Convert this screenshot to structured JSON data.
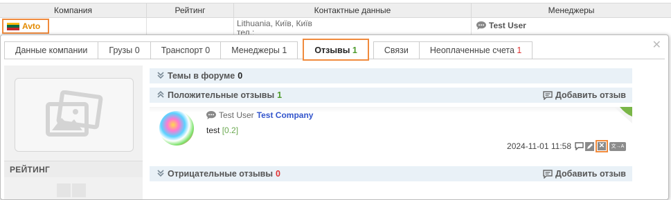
{
  "table": {
    "headers": [
      "Компания",
      "Рейтинг",
      "Контактные данные",
      "Менеджеры"
    ],
    "row": {
      "company": "Avto",
      "contact_line1": "Lithuania, Київ, Київ",
      "contact_line2": "тел.:",
      "manager": "Test User"
    }
  },
  "modal": {
    "tabs": [
      {
        "label": "Данные компании",
        "count": ""
      },
      {
        "label": "Грузы",
        "count": "0"
      },
      {
        "label": "Транспорт",
        "count": "0"
      },
      {
        "label": "Менеджеры",
        "count": "1"
      },
      {
        "label": "Отзывы",
        "count": "1"
      },
      {
        "label": "Связи",
        "count": ""
      },
      {
        "label": "Неоплаченные счета",
        "count": "1"
      }
    ],
    "active_tab": "Отзывы",
    "sidebar": {
      "rating_label": "РЕЙТИНГ"
    },
    "sections": {
      "forum": {
        "label": "Темы в форуме",
        "count": "0"
      },
      "positive": {
        "label": "Положительные отзывы",
        "count": "1",
        "add_label": "Добавить отзыв"
      },
      "negative": {
        "label": "Отрицательные отзывы",
        "count": "0",
        "add_label": "Добавить отзыв"
      }
    },
    "review": {
      "author": "Test User",
      "company": "Test Company",
      "text": "test",
      "score": "[0.2]",
      "date": "2024-11-01 11:58"
    }
  },
  "colors": {
    "accent_orange": "#f08a3c",
    "count_green": "#4c9a2a",
    "count_red": "#e03030",
    "link_blue": "#3355cc"
  }
}
